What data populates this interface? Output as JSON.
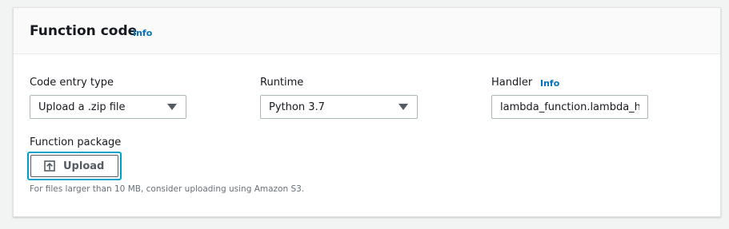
{
  "panel": {
    "title": "Function code",
    "info": "Info"
  },
  "code_entry": {
    "label": "Code entry type",
    "value": "Upload a .zip file"
  },
  "runtime": {
    "label": "Runtime",
    "value": "Python 3.7"
  },
  "handler": {
    "label": "Handler",
    "info": "Info",
    "value": "lambda_function.lambda_h"
  },
  "package": {
    "label": "Function package",
    "upload_label": "Upload",
    "hint": "For files larger than 10 MB, consider uploading using Amazon S3."
  },
  "icons": {
    "dropdown": "caret-down-icon",
    "upload": "upload-icon"
  },
  "colors": {
    "link": "#0073bb",
    "focus_ring": "#00a1c9",
    "text": "#16191f",
    "muted": "#687078"
  }
}
